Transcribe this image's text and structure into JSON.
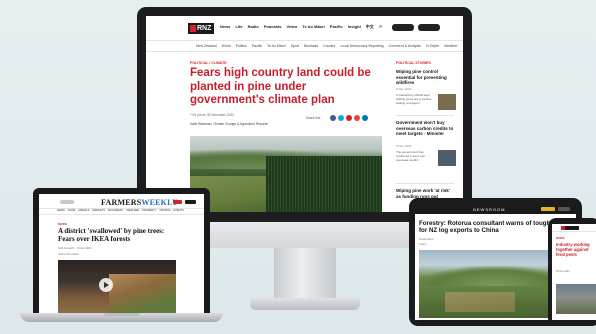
{
  "monitor": {
    "site": {
      "logo": "RNZ",
      "nav": [
        "News",
        "Life",
        "Radio",
        "Podcasts",
        "Video",
        "Te Ao Māori",
        "Pacific",
        "Insight",
        "中文"
      ],
      "subnav": [
        "New Zealand",
        "World",
        "Politics",
        "Pacific",
        "Te Ao Māori",
        "Sport",
        "Business",
        "Country",
        "Local Democracy Reporting",
        "Comment & Analysis",
        "In Depth",
        "Weather"
      ],
      "kicker": "POLITICAL / CLIMATE",
      "headline": "Fears high country land could be planted in pine under government's climate plan",
      "meta": "7:05 pm on 30 November 2023",
      "byline": "Katie Wiseman, Climate Change & Agriculture Reporter",
      "share_label": "Share this",
      "share_colors": [
        "#3b5998",
        "#1da1f2",
        "#d6202e",
        "#e0463b",
        "#0077b5"
      ],
      "sidebar_title": "POLITICAL STORIES",
      "sidebar_stories": [
        {
          "title": "Wiping pine control essential for preventing wildfires",
          "meta": "9 Dec 2023",
          "body": "A Canterbury official says wilding pines are a 'bonfire waiting to happen'",
          "thumb": "#7a6a4f"
        },
        {
          "title": "Government won't buy overseas carbon credits to meet targets - Minister",
          "meta": "8 Dec 2023",
          "body": "The government has confirmed it won't use overseas credits",
          "thumb": "#4f5d6b"
        },
        {
          "title": "Wiping pine work 'at risk' as funding runs out",
          "meta": "",
          "body": "",
          "thumb": "#5f7345"
        }
      ]
    }
  },
  "laptop": {
    "site": {
      "logo_a": "FARMERS",
      "logo_b": "WEEKLY",
      "nav": [
        "NEWS",
        "FARM",
        "ANIMALS",
        "MARKETS",
        "MACHINERY",
        "WEATHER",
        "PROPERTY",
        "OPINION",
        "EVENTS"
      ],
      "kicker": "NEWS",
      "headline": "A district 'swallowed' by pine trees: Fears over IKEA forests",
      "meta": "Nick Howarth · 2 Dec 2023",
      "share": "Share this article"
    }
  },
  "tablet": {
    "site": {
      "logo": "NEWSROOM",
      "headline": "Forestry: Rotorua consultant warns of tough times for NZ log exports to China",
      "meta": "Rural News",
      "share": "Share"
    }
  },
  "phone": {
    "site": {
      "kicker": "RURAL",
      "headline": "Industry working together against feral pests",
      "meta": "29 Nov 2023"
    }
  }
}
